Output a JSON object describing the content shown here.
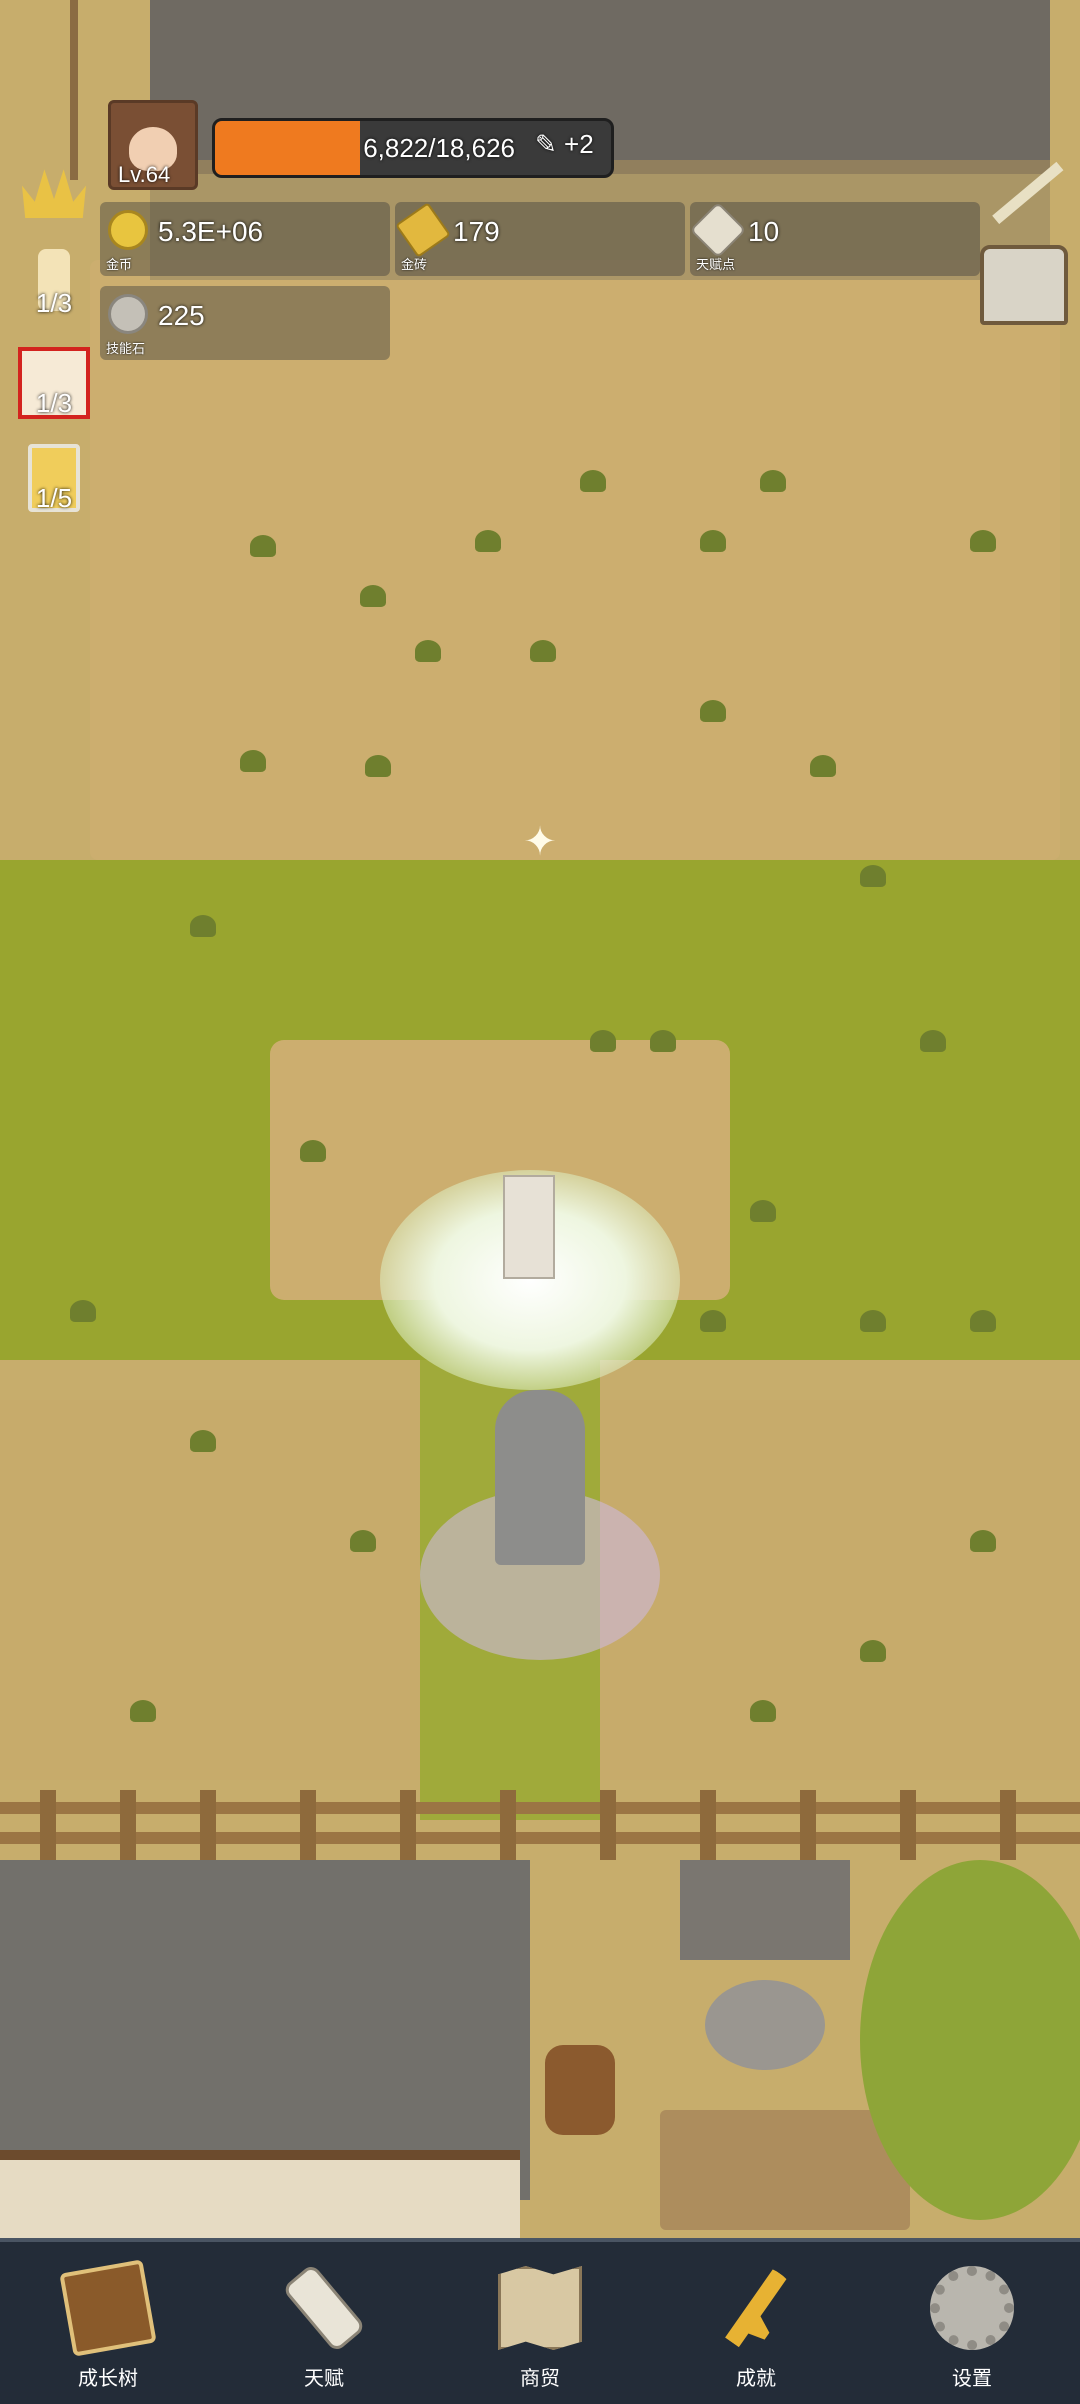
{
  "player": {
    "level": "Lv.64",
    "xp_text": "6,822/18,626",
    "xp_fraction": 0.366,
    "xp_bonus": "+2"
  },
  "resources": {
    "coins": {
      "value": "5.3E+06",
      "label": "金币",
      "icon": "coin-icon"
    },
    "gold_bars": {
      "value": "179",
      "label": "金砖",
      "icon": "gold-bar-icon"
    },
    "talent_points": {
      "value": "10",
      "label": "天赋点",
      "icon": "scroll-icon"
    },
    "skill_stones": {
      "value": "225",
      "label": "技能石",
      "icon": "stone-icon"
    }
  },
  "side_buffs": [
    {
      "name": "crown-icon",
      "count": ""
    },
    {
      "name": "candle-icon",
      "count": "1/3"
    },
    {
      "name": "dice-icon",
      "count": "1/3"
    },
    {
      "name": "beer-mug-icon",
      "count": "1/5"
    }
  ],
  "nav": [
    {
      "label": "成长树",
      "icon": "book-icon"
    },
    {
      "label": "天赋",
      "icon": "scroll-icon"
    },
    {
      "label": "商贸",
      "icon": "map-icon"
    },
    {
      "label": "成就",
      "icon": "key-icon"
    },
    {
      "label": "设置",
      "icon": "gear-icon"
    }
  ],
  "colors": {
    "xp_fill": "#ef7a1f",
    "nav_bg": "#232c38",
    "grass": "#99a52f",
    "dirt": "#ccae6f"
  }
}
